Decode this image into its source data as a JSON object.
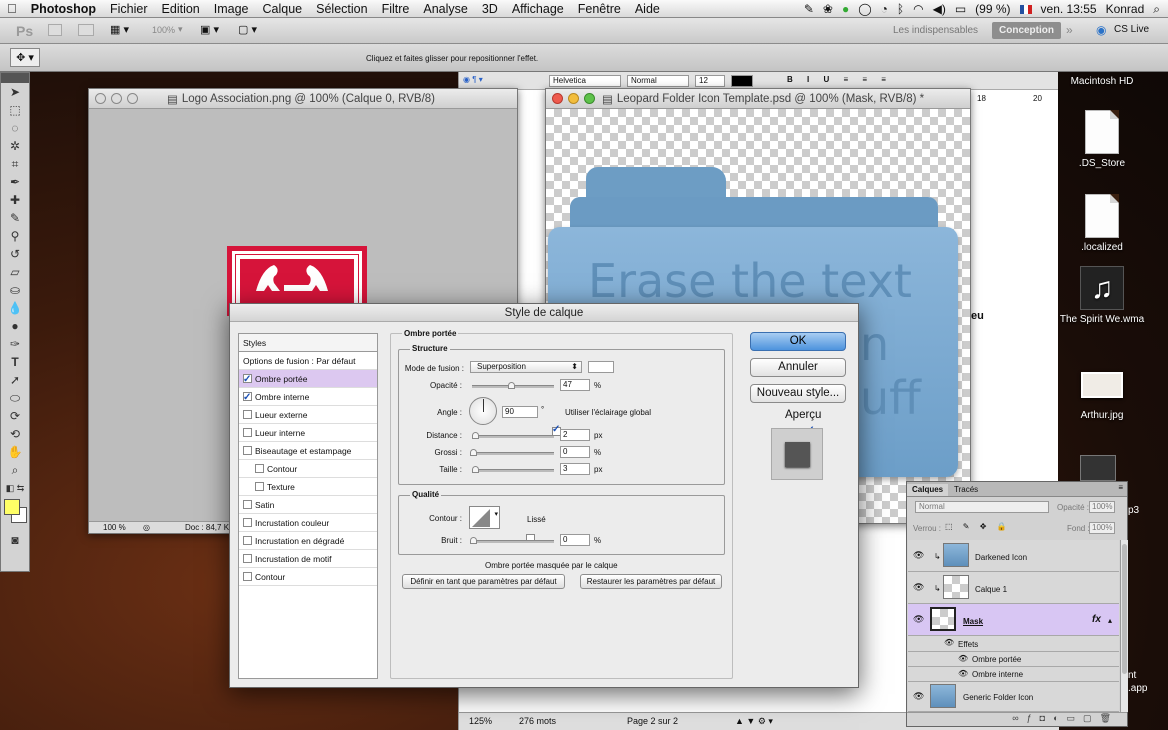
{
  "menubar": {
    "app": "Photoshop",
    "items": [
      "Fichier",
      "Edition",
      "Image",
      "Calque",
      "Sélection",
      "Filtre",
      "Analyse",
      "3D",
      "Affichage",
      "Fenêtre",
      "Aide"
    ],
    "battery": "(99 %)",
    "clock": "ven. 13:55",
    "user": "Konrad"
  },
  "appbar": {
    "zoom": "100%",
    "ws_essentials": "Les indispensables",
    "ws_design": "Conception",
    "cs_live": "CS Live"
  },
  "options": {
    "hint": "Cliquez et faites glisser pour repositionner l'effet.",
    "font": "Helvetica",
    "weight": "Normal",
    "size": "12",
    "ruler_a": "18",
    "ruler_b": "20"
  },
  "doc1": {
    "title": "Logo Association.png @ 100% (Calque 0, RVB/8)",
    "zoom": "100 %",
    "status": "Doc : 84,7 K"
  },
  "doc2": {
    "title": "Leopard Folder Icon Template.psd @ 100% (Mask, RVB/8) *",
    "folder_text": "Erase the text",
    "folder_text2": "n",
    "folder_text3": "uff"
  },
  "word": {
    "zoom": "125%",
    "words": "276 mots",
    "pages": "Page 2 sur 2",
    "fragment": "eu"
  },
  "dialog": {
    "title": "Style de calque",
    "styles_header": "Styles",
    "styles": [
      {
        "label": "Options de fusion : Par défaut",
        "check": null,
        "selected": false,
        "indent": false
      },
      {
        "label": "Ombre portée",
        "check": true,
        "selected": true,
        "indent": false
      },
      {
        "label": "Ombre interne",
        "check": true,
        "selected": false,
        "indent": false
      },
      {
        "label": "Lueur externe",
        "check": false,
        "selected": false,
        "indent": false
      },
      {
        "label": "Lueur interne",
        "check": false,
        "selected": false,
        "indent": false
      },
      {
        "label": "Biseautage et estampage",
        "check": false,
        "selected": false,
        "indent": false
      },
      {
        "label": "Contour",
        "check": false,
        "selected": false,
        "indent": true
      },
      {
        "label": "Texture",
        "check": false,
        "selected": false,
        "indent": true
      },
      {
        "label": "Satin",
        "check": false,
        "selected": false,
        "indent": false
      },
      {
        "label": "Incrustation couleur",
        "check": false,
        "selected": false,
        "indent": false
      },
      {
        "label": "Incrustation en dégradé",
        "check": false,
        "selected": false,
        "indent": false
      },
      {
        "label": "Incrustation de motif",
        "check": false,
        "selected": false,
        "indent": false
      },
      {
        "label": "Contour",
        "check": false,
        "selected": false,
        "indent": false
      }
    ],
    "section": "Ombre portée",
    "structure": "Structure",
    "blend_label": "Mode de fusion :",
    "blend_value": "Superposition",
    "opacity_label": "Opacité :",
    "opacity_value": "47",
    "opacity_level": 0.47,
    "angle_label": "Angle :",
    "angle_value": "90",
    "global_light_label": "Utiliser l'éclairage global",
    "distance_label": "Distance :",
    "distance_value": "2",
    "spread_label": "Grossi :",
    "spread_value": "0",
    "size_label": "Taille :",
    "size_value": "3",
    "unit_px": "px",
    "unit_pct": "%",
    "quality": "Qualité",
    "contour_label": "Contour :",
    "smooth_label": "Lissé",
    "noise_label": "Bruit :",
    "noise_value": "0",
    "knockout_label": "Ombre portée masquée par le calque",
    "btn_set_default": "Définir en tant que paramètres par défaut",
    "btn_reset_default": "Restaurer les paramètres par défaut",
    "btn_ok": "OK",
    "btn_cancel": "Annuler",
    "btn_new_style": "Nouveau style...",
    "preview_label": "Aperçu"
  },
  "layers": {
    "tab_layers": "Calques",
    "tab_channels": "Tracés",
    "blend": "Normal",
    "opacity_label": "Opacité :",
    "opacity": "100%",
    "lock_label": "Verrou :",
    "fill_label": "Fond :",
    "fill": "100%",
    "items": [
      {
        "name": "Darkened Icon"
      },
      {
        "name": "Calque 1"
      },
      {
        "name": "Mask"
      }
    ],
    "effects_label": "Effets",
    "effect1": "Ombre portée",
    "effect2": "Ombre interne",
    "bottom_layer": "Generic Folder Icon",
    "fx": "fx"
  },
  "desktop": {
    "hd": "Macintosh HD",
    "icon1": ".DS_Store",
    "icon2": ".localized",
    "icon3": "The Spirit We.wma",
    "icon4": "Arthur.jpg",
    "frag1": "p3",
    "frag2": "nt",
    "frag3": ".app"
  }
}
